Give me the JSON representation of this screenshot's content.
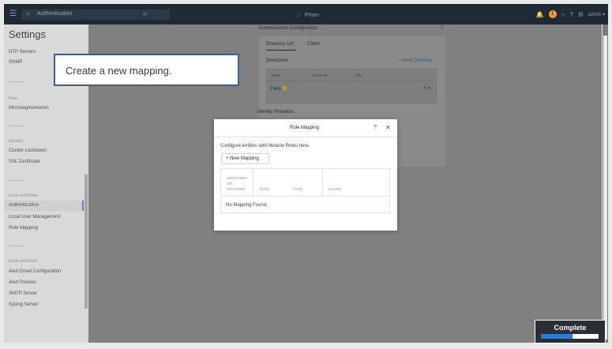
{
  "topbar": {
    "menu_icon": "hamburger-icon",
    "search_icon": "search-icon",
    "search_value": "Authentication",
    "clear_icon": "close-icon",
    "logo_text": "Prism",
    "alert_count": "1",
    "help_icon": "question-icon",
    "gear_icon": "gear-icon",
    "user": "admin"
  },
  "sidebar": {
    "title": "Settings",
    "items": {
      "ntp": "NTP Servers",
      "snmp": "SNMP",
      "flow_section": "Flow",
      "microseg": "Microsegmentation",
      "security_section": "Security",
      "lockdown": "Cluster Lockdown",
      "ssl": "SSL Certificate",
      "users_section": "Users and Roles",
      "authentication": "Authentication",
      "local_user": "Local User Management",
      "role_mapping": "Role Mapping",
      "email_section": "Email and Alerts",
      "alert_email": "Alert Email Configuration",
      "alert_policies": "Alert Policies",
      "smtp": "SMTP Server",
      "syslog": "Syslog Server"
    }
  },
  "background": {
    "auth_title": "Authentication Configuration",
    "auth_help": "?",
    "tab_directory": "Directory List",
    "tab_client": "Client",
    "directories": "Directories",
    "new_directory": "+ New Directory",
    "col_name": "NAME",
    "col_domain": "DOMAIN",
    "col_url": "URL",
    "row_name": "Files",
    "row_actions": "✎  ✕",
    "identity_providers": "Identity Providers"
  },
  "callout": {
    "text": "Create a new mapping."
  },
  "modal": {
    "title": "Role Mapping",
    "help": "?",
    "close": "✕",
    "description": "Configure entities with Nutanix Roles here.",
    "new_mapping": "+ New Mapping",
    "col1_line1": "DIRECTORY",
    "col1_line2": "OR",
    "col1_line3": "PROVIDER",
    "col_role": "ROLE",
    "col_type": "TYPE",
    "col_values": "VALUES",
    "empty": "No Mapping Found."
  },
  "progress": {
    "label": "Complete",
    "fraction": 0.55,
    "accent": "#2f7ad6"
  }
}
